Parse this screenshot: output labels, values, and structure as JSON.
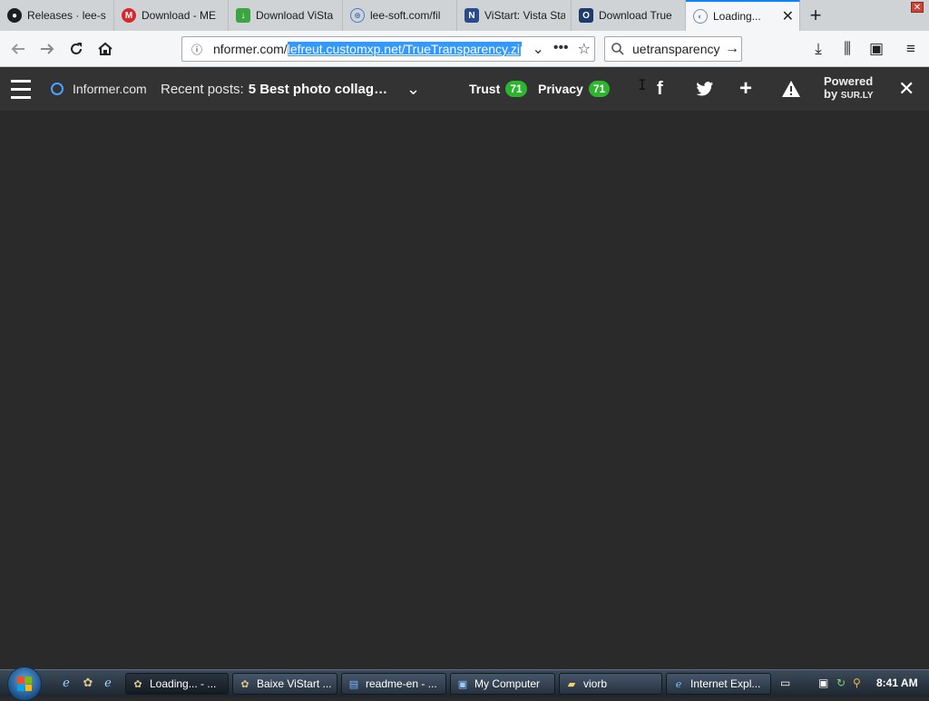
{
  "tabs": [
    {
      "label": "Releases · lee-s",
      "icon": "github-icon",
      "color": "#1b1f23"
    },
    {
      "label": "Download - ME",
      "icon": "mega-icon",
      "color": "#d9272e"
    },
    {
      "label": "Download ViSta",
      "icon": "download-green-icon",
      "color": "#3aa541"
    },
    {
      "label": "lee-soft.com/fil",
      "icon": "globe-icon",
      "color": "#4b77c6"
    },
    {
      "label": "ViStart: Vista Sta",
      "icon": "vistart-icon",
      "color": "#2b4c8c"
    },
    {
      "label": "Download True",
      "icon": "informer-icon",
      "color": "#1e3b6b"
    },
    {
      "label": "Loading...",
      "icon": "loading-globe-icon",
      "color": "#7a8aa0",
      "active": true
    }
  ],
  "url": {
    "prefix": "nformer.com/",
    "selected": "lefreut.customxp.net/TrueTransparency.zip"
  },
  "search": {
    "text": "uetransparency"
  },
  "infobar": {
    "site": "Informer.com",
    "recent_label": "Recent posts:",
    "recent_title": "5 Best photo collag…",
    "trust_label": "Trust",
    "trust_score": "71",
    "privacy_label": "Privacy",
    "privacy_score": "71",
    "powered_line1": "Powered",
    "powered_line2": "by",
    "powered_brand": "SUR.LY"
  },
  "taskbar": {
    "items": [
      {
        "label": "Loading... - ...",
        "icon": "firefox-icon"
      },
      {
        "label": "Baixe ViStart ...",
        "icon": "firefox-icon"
      },
      {
        "label": "readme-en - ...",
        "icon": "notepad-icon"
      },
      {
        "label": "My Computer",
        "icon": "computer-icon"
      },
      {
        "label": "viorb",
        "icon": "folder-icon"
      },
      {
        "label": "Internet Expl...",
        "icon": "ie-icon"
      }
    ],
    "clock": "8:41 AM"
  }
}
